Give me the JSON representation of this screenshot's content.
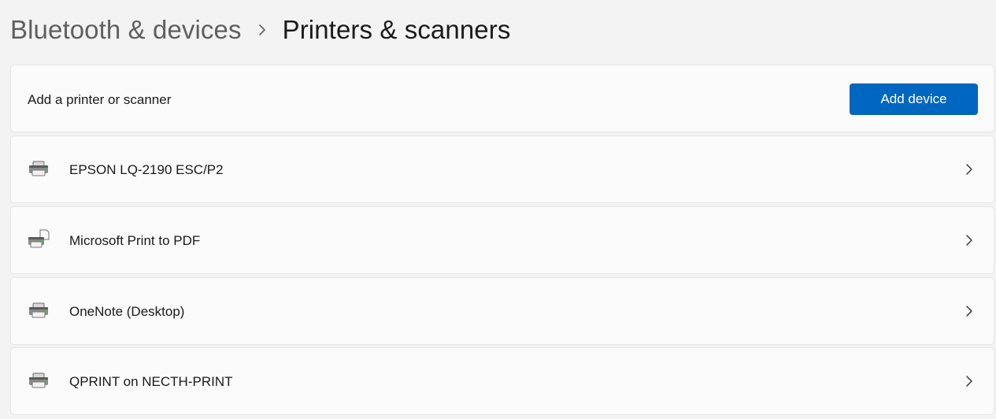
{
  "breadcrumb": {
    "parent": "Bluetooth & devices",
    "separator_icon": "chevron-right-icon",
    "current": "Printers & scanners"
  },
  "add_section": {
    "label": "Add a printer or scanner",
    "button_label": "Add device"
  },
  "devices": [
    {
      "name": "EPSON LQ-2190 ESC/P2",
      "icon": "printer-icon"
    },
    {
      "name": "Microsoft Print to PDF",
      "icon": "pdf-printer-icon"
    },
    {
      "name": "OneNote (Desktop)",
      "icon": "printer-icon"
    },
    {
      "name": "QPRINT on NECTH-PRINT",
      "icon": "printer-icon"
    }
  ],
  "colors": {
    "accent": "#0067c0",
    "background": "#f3f3f3",
    "card": "#fbfbfb"
  }
}
